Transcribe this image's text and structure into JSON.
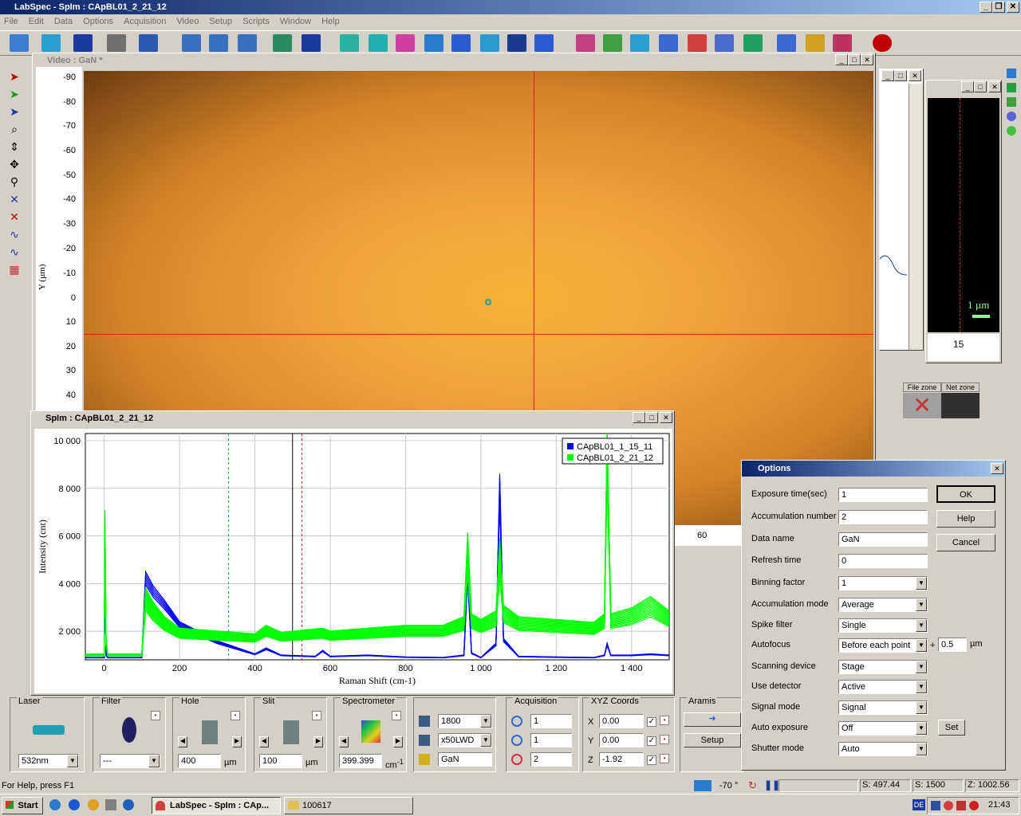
{
  "app": {
    "title": "LabSpec - SpIm : CApBL01_2_21_12",
    "menu": [
      "File",
      "Edit",
      "Data",
      "Options",
      "Acquisition",
      "Video",
      "Setup",
      "Scripts",
      "Window",
      "Help"
    ],
    "window_controls": [
      "_",
      "❐",
      "✕"
    ]
  },
  "toolbar_icons": [
    "open-icon",
    "save-icon",
    "print-icon",
    "help-icon",
    "map-icon",
    "stop-icon"
  ],
  "video": {
    "title": "Video : GaN *",
    "y_axis_label": "Y (µm)",
    "y_ticks": [
      "-90",
      "-80",
      "-70",
      "-60",
      "-50",
      "-40",
      "-30",
      "-20",
      "-10",
      "0",
      "10",
      "20",
      "30",
      "40"
    ],
    "x_tick_visible": "60"
  },
  "side_panel": {
    "x_tick": "15",
    "scale_label": "1 µm",
    "file_zone": "File zone",
    "net_zone": "Net zone"
  },
  "spectrum_window": {
    "title": "SpIm : CApBL01_2_21_12"
  },
  "chart_data": {
    "type": "line",
    "xlabel": "Raman Shift (cm-1)",
    "ylabel": "Intensity (cnt)",
    "xlim": [
      -50,
      1500
    ],
    "ylim": [
      800,
      10300
    ],
    "x_ticks": [
      "0",
      "200",
      "400",
      "600",
      "800",
      "1 000",
      "1 200",
      "1 400"
    ],
    "x_tick_values": [
      0,
      200,
      400,
      600,
      800,
      1000,
      1200,
      1400
    ],
    "y_ticks": [
      "2 000",
      "4 000",
      "6 000",
      "8 000",
      "10 000"
    ],
    "y_tick_values": [
      2000,
      4000,
      6000,
      8000,
      10000
    ],
    "grid": true,
    "legend_position": "top-right",
    "series": [
      {
        "name": "CApBL01_1_15_11",
        "color": "#0000ff",
        "x": [
          -50,
          0,
          2,
          5,
          10,
          50,
          100,
          110,
          130,
          160,
          200,
          300,
          400,
          430,
          470,
          560,
          580,
          600,
          700,
          800,
          900,
          955,
          965,
          975,
          1000,
          1040,
          1050,
          1060,
          1100,
          1200,
          1300,
          1328,
          1335,
          1345,
          1400,
          1450,
          1500
        ],
        "y": [
          900,
          900,
          4300,
          1000,
          900,
          900,
          900,
          4500,
          3900,
          3300,
          2400,
          1600,
          1050,
          1300,
          1000,
          950,
          1200,
          950,
          1000,
          920,
          900,
          1000,
          4800,
          1100,
          900,
          1500,
          8600,
          1700,
          950,
          920,
          900,
          1000,
          1500,
          1000,
          1000,
          1050,
          1000
        ]
      },
      {
        "name": "CApBL01_2_21_12",
        "color": "#00ff00",
        "x": [
          -50,
          0,
          2,
          5,
          10,
          50,
          100,
          110,
          130,
          160,
          200,
          300,
          400,
          430,
          470,
          580,
          600,
          700,
          800,
          900,
          955,
          965,
          975,
          1000,
          1040,
          1050,
          1060,
          1100,
          1200,
          1300,
          1328,
          1335,
          1345,
          1400,
          1450,
          1500
        ],
        "y": [
          1000,
          1000,
          6000,
          1500,
          1000,
          1000,
          1000,
          3300,
          2800,
          2300,
          1900,
          1800,
          1700,
          2000,
          1750,
          1900,
          1800,
          1900,
          2000,
          2000,
          2300,
          5200,
          2400,
          2200,
          2500,
          5000,
          2700,
          2300,
          2200,
          2100,
          2400,
          10000,
          2400,
          2600,
          3000,
          2500
        ]
      }
    ]
  },
  "bottom_panels": {
    "laser": {
      "label": "Laser",
      "value": "532nm"
    },
    "filter": {
      "label": "Filter",
      "value": "---"
    },
    "hole": {
      "label": "Hole",
      "value": "400",
      "unit": "µm"
    },
    "slit": {
      "label": "Slit",
      "value": "100",
      "unit": "µm"
    },
    "spectrometer": {
      "label": "Spectrometer",
      "value": "399.399",
      "unit": "cm",
      "unit_sup": "-1"
    },
    "grating": {
      "value": "1800",
      "objective": "x50LWD",
      "sample": "GaN"
    },
    "acquisition": {
      "label": "Acquisition",
      "values": [
        "1",
        "1",
        "2"
      ]
    },
    "xyz": {
      "label": "XYZ Coords",
      "x_label": "X",
      "x": "0.00",
      "y_label": "Y",
      "y": "0.00",
      "z_label": "Z",
      "z": "-1.92"
    },
    "aramis": {
      "label": "Aramis",
      "setup": "Setup"
    }
  },
  "options_dialog": {
    "title": "Options",
    "rows": [
      {
        "label": "Exposure time(sec)",
        "value": "1",
        "type": "text"
      },
      {
        "label": "Accumulation number",
        "value": "2",
        "type": "text"
      },
      {
        "label": "Data name",
        "value": "GaN",
        "type": "text"
      },
      {
        "label": "Refresh time",
        "value": "0",
        "type": "text"
      },
      {
        "label": "Binning factor",
        "value": "1",
        "type": "select"
      },
      {
        "label": "Accumulation mode",
        "value": "Average",
        "type": "select"
      },
      {
        "label": "Spike filter",
        "value": "Single",
        "type": "select"
      },
      {
        "label": "Autofocus",
        "value": "Before each point",
        "type": "select"
      },
      {
        "label": "Scanning device",
        "value": "Stage",
        "type": "select"
      },
      {
        "label": "Use detector",
        "value": "Active",
        "type": "select"
      },
      {
        "label": "Signal mode",
        "value": "Signal",
        "type": "select"
      },
      {
        "label": "Auto exposure",
        "value": "Off",
        "type": "select"
      },
      {
        "label": "Shutter mode",
        "value": "Auto",
        "type": "select"
      }
    ],
    "autofocus_plus": "+",
    "autofocus_extra": "0.5",
    "autofocus_unit": "µm",
    "ok": "OK",
    "help": "Help",
    "cancel": "Cancel",
    "set": "Set"
  },
  "statusbar": {
    "help_text": "For Help, press F1",
    "temp": "-70",
    "temp_unit": "°",
    "s_value": "S: 497.44",
    "s2_value": "S: 1500",
    "z_value": "Z: 1002.56"
  },
  "taskbar": {
    "start": "Start",
    "task1": "LabSpec - SpIm : CAp...",
    "task2": "100617",
    "lang": "DE",
    "clock": "21:43"
  }
}
